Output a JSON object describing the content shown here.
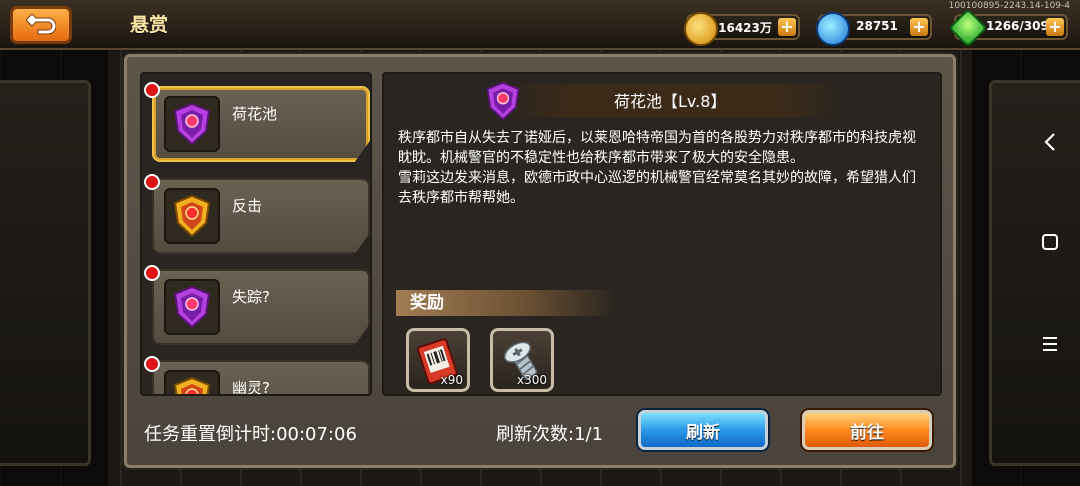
{
  "app": {
    "title": "悬赏",
    "watermark": "100100895-2243.14-109-4"
  },
  "resources": [
    {
      "value": "16423万",
      "icon": "gold-coin-icon"
    },
    {
      "value": "28751",
      "icon": "blue-crystal-icon"
    },
    {
      "value": "1266/309",
      "icon": "green-energy-icon"
    }
  ],
  "quests": [
    {
      "label": "荷花池",
      "selected": true,
      "emblem": "purple-shield-emblem-icon"
    },
    {
      "label": "反击",
      "selected": false,
      "emblem": "gold-shield-emblem-icon"
    },
    {
      "label": "失踪?",
      "selected": false,
      "emblem": "purple-shield-emblem-icon"
    },
    {
      "label": "幽灵?",
      "selected": false,
      "emblem": "gold-shield-emblem-icon"
    }
  ],
  "detail": {
    "title": "荷花池【Lv.8】",
    "paragraphs": [
      "秩序都市自从失去了诺娅后，以莱恩哈特帝国为首的各股势力对秩序都市的科技虎视眈眈。机械警官的不稳定性也给秩序都市带来了极大的安全隐患。",
      "雪莉这边发来消息，欧德市政中心巡逻的机械警官经常莫名其妙的故障，希望猎人们去秩序都市帮帮她。"
    ],
    "reward_title": "奖励",
    "rewards": [
      {
        "icon": "ticket-coupon-icon",
        "qty": "x90"
      },
      {
        "icon": "screw-bolt-icon",
        "qty": "x300"
      }
    ]
  },
  "footer": {
    "reset_countdown": "任务重置倒计时:00:07:06",
    "refresh_count": "刷新次数:1/1",
    "refresh_button": "刷新",
    "go_button": "前往"
  },
  "colors": {
    "accent_gold": "#f0c24a",
    "refresh_blue": "#2a9ae8",
    "go_orange": "#ff8a20",
    "alert_red": "#e01414"
  }
}
